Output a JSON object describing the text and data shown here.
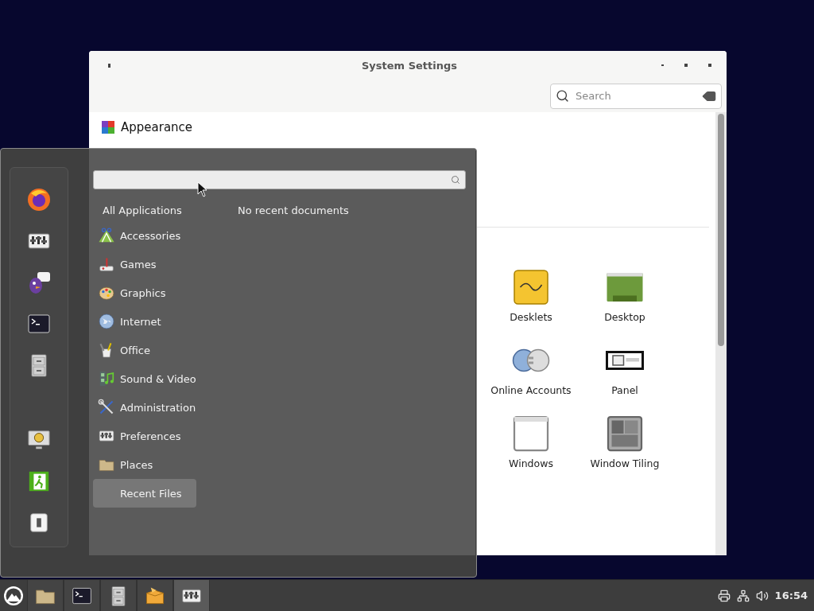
{
  "settings_window": {
    "title": "System Settings",
    "search": {
      "placeholder": "Search"
    },
    "appearance_heading": "Appearance",
    "preference_items": [
      {
        "label": "Desklets",
        "kind": "notes"
      },
      {
        "label": "Desktop",
        "kind": "desktop"
      },
      {
        "label": "Online Accounts",
        "kind": "accounts"
      },
      {
        "label": "Panel",
        "kind": "panel"
      },
      {
        "label": "Windows",
        "kind": "window"
      },
      {
        "label": "Window Tiling",
        "kind": "tiling"
      }
    ]
  },
  "menu": {
    "favorites": [
      {
        "kind": "browser"
      },
      {
        "kind": "settings"
      },
      {
        "kind": "chat"
      },
      {
        "kind": "terminal"
      },
      {
        "kind": "cabinet"
      }
    ],
    "session_buttons": [
      {
        "kind": "lock"
      },
      {
        "kind": "logout"
      },
      {
        "kind": "power"
      }
    ],
    "categories": [
      {
        "label": "All Applications",
        "kind": "all",
        "selected": false
      },
      {
        "label": "Accessories",
        "kind": "accessories",
        "selected": false
      },
      {
        "label": "Games",
        "kind": "games",
        "selected": false
      },
      {
        "label": "Graphics",
        "kind": "graphics",
        "selected": false
      },
      {
        "label": "Internet",
        "kind": "internet",
        "selected": false
      },
      {
        "label": "Office",
        "kind": "office",
        "selected": false
      },
      {
        "label": "Sound & Video",
        "kind": "media",
        "selected": false
      },
      {
        "label": "Administration",
        "kind": "admin",
        "selected": false
      },
      {
        "label": "Preferences",
        "kind": "settings",
        "selected": false
      },
      {
        "label": "Places",
        "kind": "folder",
        "selected": false
      },
      {
        "label": "Recent Files",
        "kind": "recent",
        "selected": true
      }
    ],
    "recent_message": "No recent documents"
  },
  "taskbar": {
    "launchers": [
      {
        "kind": "folder",
        "active": false
      },
      {
        "kind": "terminal",
        "active": false
      },
      {
        "kind": "cabinet",
        "active": false
      },
      {
        "kind": "package",
        "active": false
      },
      {
        "kind": "settings",
        "active": true
      }
    ],
    "clock": "16:54"
  }
}
